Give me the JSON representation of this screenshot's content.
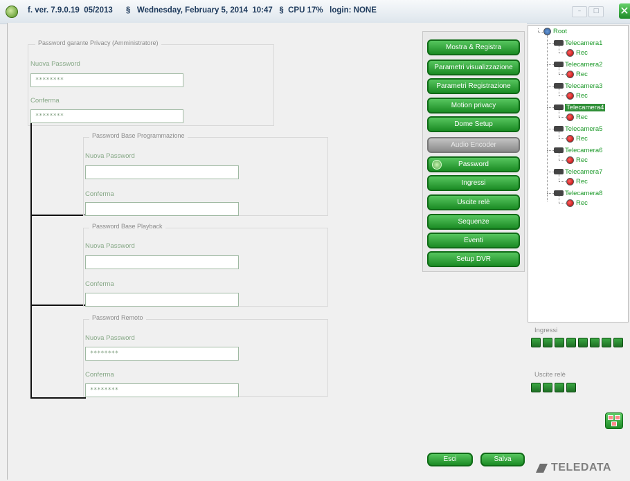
{
  "window": {
    "title": "f. ver. 7.9.0.19  05/2013      §   Wednesday, February 5, 2014  10:47   §  CPU 17%   login: NONE"
  },
  "password_sections": {
    "admin": {
      "legend": "Password garante Privacy (Amministratore)",
      "new_label": "Nuova Password",
      "new_value": "********",
      "confirm_label": "Conferma",
      "confirm_value": "********"
    },
    "programming": {
      "legend": "Password Base Programmazione",
      "new_label": "Nuova Password",
      "new_value": "",
      "confirm_label": "Conferma",
      "confirm_value": ""
    },
    "playback": {
      "legend": "Password Base Playback",
      "new_label": "Nuova Password",
      "new_value": "",
      "confirm_label": "Conferma",
      "confirm_value": ""
    },
    "remote": {
      "legend": "Password Remoto",
      "new_label": "Nuova Password",
      "new_value": "********",
      "confirm_label": "Conferma",
      "confirm_value": "********"
    }
  },
  "menu": {
    "items": [
      {
        "label": "Mostra & Registra",
        "disabled": false
      },
      {
        "label": "Parametri visualizzazione",
        "disabled": false
      },
      {
        "label": "Parametri Registrazione",
        "disabled": false
      },
      {
        "label": "Motion privacy",
        "disabled": false
      },
      {
        "label": "Dome Setup",
        "disabled": false
      },
      {
        "label": "Audio Encoder",
        "disabled": true
      },
      {
        "label": "Password",
        "disabled": false,
        "active": true
      },
      {
        "label": "Ingressi",
        "disabled": false
      },
      {
        "label": "Uscite relè",
        "disabled": false
      },
      {
        "label": "Sequenze",
        "disabled": false
      },
      {
        "label": "Eventi",
        "disabled": false
      },
      {
        "label": "Setup DVR",
        "disabled": false
      }
    ]
  },
  "tree": {
    "root": "Root",
    "rec_label": "Rec",
    "cameras": [
      "Telecamera1",
      "Telecamera2",
      "Telecamera3",
      "Telecamera4",
      "Telecamera5",
      "Telecamera6",
      "Telecamera7",
      "Telecamera8"
    ],
    "selected": "Telecamera4"
  },
  "side": {
    "inputs_label": "Ingressi",
    "inputs_count": 8,
    "relays_label": "Uscite relè",
    "relays_count": 4
  },
  "footer": {
    "exit_label": "Esci",
    "save_label": "Salva",
    "brand": "TELEDATA"
  },
  "colors": {
    "accent_green": "#1b8b24",
    "label_green": "#86a886",
    "tree_green": "#1d9a2a"
  }
}
